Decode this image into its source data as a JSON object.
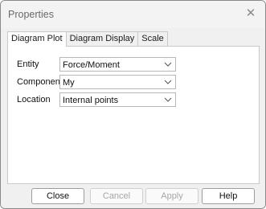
{
  "window": {
    "title": "Properties",
    "close_icon": "close-icon"
  },
  "tabs": [
    {
      "label": "Diagram Plot",
      "active": true
    },
    {
      "label": "Diagram Display",
      "active": false
    },
    {
      "label": "Scale",
      "active": false
    }
  ],
  "fields": [
    {
      "label": "Entity",
      "value": "Force/Moment"
    },
    {
      "label": "Component",
      "value": "My"
    },
    {
      "label": "Location",
      "value": "Internal points"
    }
  ],
  "buttons": {
    "close": {
      "label": "Close",
      "enabled": true
    },
    "cancel": {
      "label": "Cancel",
      "enabled": false
    },
    "apply": {
      "label": "Apply",
      "enabled": false
    },
    "help": {
      "label": "Help",
      "enabled": true
    }
  }
}
